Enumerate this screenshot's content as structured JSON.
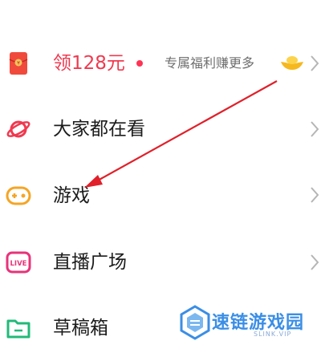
{
  "menu": {
    "items": [
      {
        "label": "领128元",
        "subtitle": "专属福利赚更多",
        "icon": "red-envelope-icon"
      },
      {
        "label": "大家都在看",
        "icon": "planet-icon"
      },
      {
        "label": "游戏",
        "icon": "gamepad-icon"
      },
      {
        "label": "直播广场",
        "icon": "live-icon",
        "icon_text": "LIVE"
      },
      {
        "label": "草稿箱",
        "icon": "folder-icon"
      }
    ]
  },
  "watermark": {
    "text": "速链游戏园",
    "subtext": "SLINK.VIP"
  },
  "colors": {
    "accent": "#f0394f",
    "watermark": "#3a8ee6",
    "arrow": "#e0202a"
  }
}
